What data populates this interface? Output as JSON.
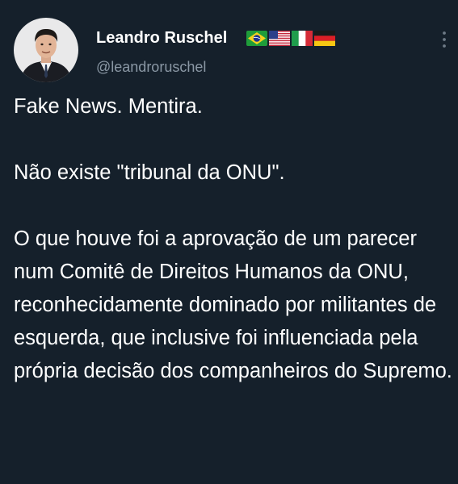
{
  "author": {
    "name": "Leandro Ruschel",
    "handle": "@leandroruschel",
    "flags": [
      "brazil-flag-icon",
      "usa-flag-icon",
      "italy-flag-icon",
      "germany-flag-icon"
    ],
    "avatar": "avatar-photo"
  },
  "colors": {
    "background": "#15202b",
    "text": "#ffffff",
    "muted": "#8b98a5"
  },
  "tweet": {
    "paragraphs": [
      "Fake News. Mentira.",
      "Não existe \"tribunal da ONU\".",
      "O que houve foi a aprovação de um parecer num Comitê de Direitos Humanos da ONU, reconhecidamente dominado por militantes de esquerda, que inclusive foi influenciada pela própria decisão dos companheiros do Supremo."
    ]
  },
  "menu": {
    "icon": "more-vertical-icon"
  }
}
